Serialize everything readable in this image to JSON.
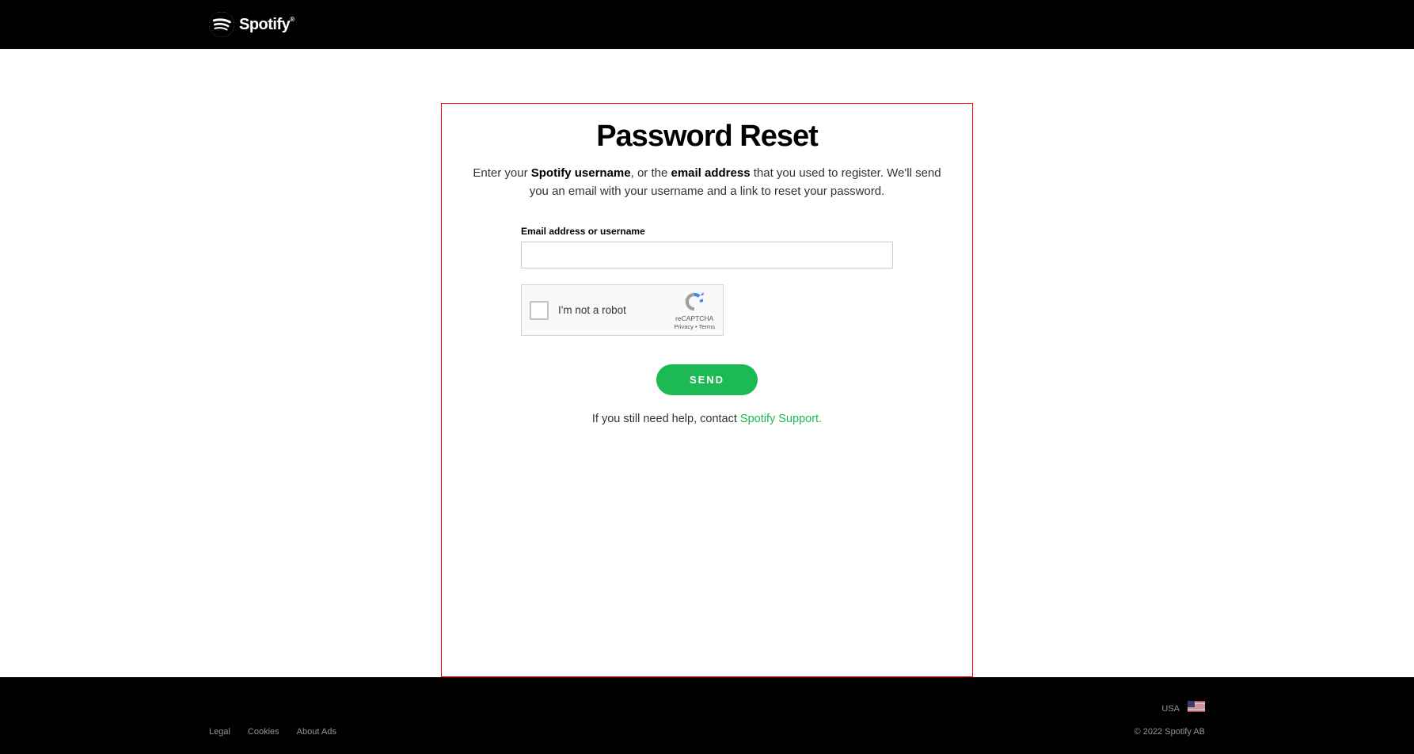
{
  "header": {
    "brand": "Spotify"
  },
  "card": {
    "title": "Password Reset",
    "desc_pre": "Enter your ",
    "desc_b1": "Spotify username",
    "desc_mid": ", or the ",
    "desc_b2": "email address",
    "desc_post": " that you used to register. We'll send you an email with your username and a link to reset your password.",
    "field_label": "Email address or username",
    "recaptcha_label": "I'm not a robot",
    "recaptcha_brand": "reCAPTCHA",
    "recaptcha_privacy": "Privacy",
    "recaptcha_terms": "Terms",
    "send_label": "SEND",
    "help_text": "If you still need help, contact ",
    "help_link": "Spotify Support."
  },
  "footer": {
    "country": "USA",
    "links": {
      "legal": "Legal",
      "cookies": "Cookies",
      "ads": "About Ads"
    },
    "copyright": "© 2022 Spotify AB"
  }
}
